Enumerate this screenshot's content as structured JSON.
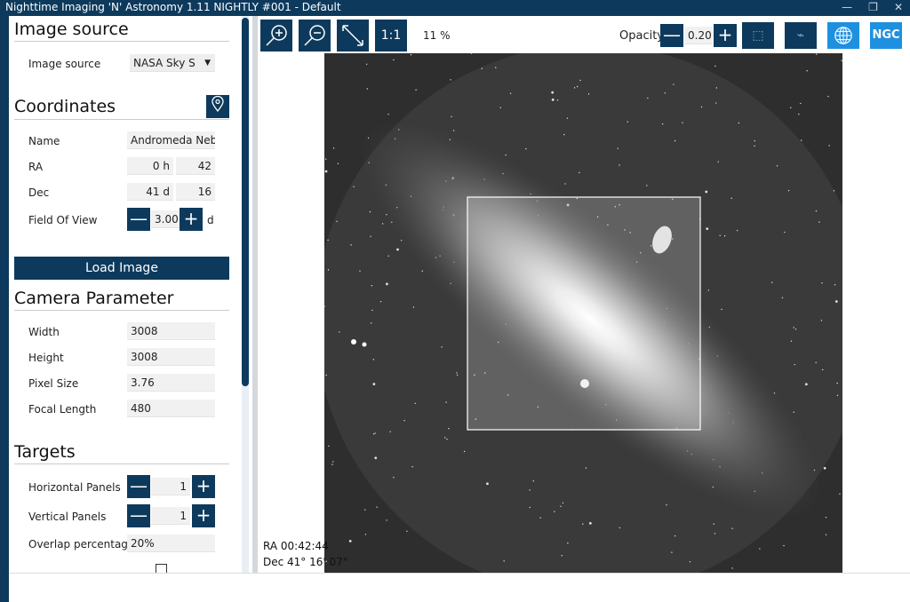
{
  "window": {
    "title": "Nighttime Imaging 'N' Astronomy 1.11 NIGHTLY #001  -  Default"
  },
  "image_source": {
    "heading": "Image source",
    "label": "Image source",
    "value": "NASA Sky S"
  },
  "coordinates": {
    "heading": "Coordinates",
    "name_label": "Name",
    "name_value": "Andromeda Neb",
    "ra_label": "RA",
    "ra_h": "0",
    "ra_h_unit": "h",
    "ra_m": "42",
    "dec_label": "Dec",
    "dec_d": "41",
    "dec_d_unit": "d",
    "dec_m": "16",
    "fov_label": "Field Of View",
    "fov_value": "3.00",
    "fov_unit": "d"
  },
  "load_image": "Load Image",
  "camera": {
    "heading": "Camera Parameter",
    "rows": [
      {
        "label": "Width",
        "value": "3008"
      },
      {
        "label": "Height",
        "value": "3008"
      },
      {
        "label": "Pixel Size",
        "value": "3.76"
      },
      {
        "label": "Focal Length",
        "value": "480"
      }
    ]
  },
  "targets": {
    "heading": "Targets",
    "h_panels_label": "Horizontal Panels",
    "h_panels": "1",
    "v_panels_label": "Vertical Panels",
    "v_panels": "1",
    "overlap_label": "Overlap percentag",
    "overlap": "20%"
  },
  "toolbar": {
    "one_to_one": "1:1",
    "zoom": "11 %",
    "opacity_label": "Opacity",
    "opacity": "0.20",
    "ngc": "NGC"
  },
  "readout": {
    "ra": "RA  00:42:44",
    "dec": "Dec  41° 16' 07\""
  },
  "colors": {
    "primary": "#0d3a5c",
    "accent": "#1e90e0"
  }
}
